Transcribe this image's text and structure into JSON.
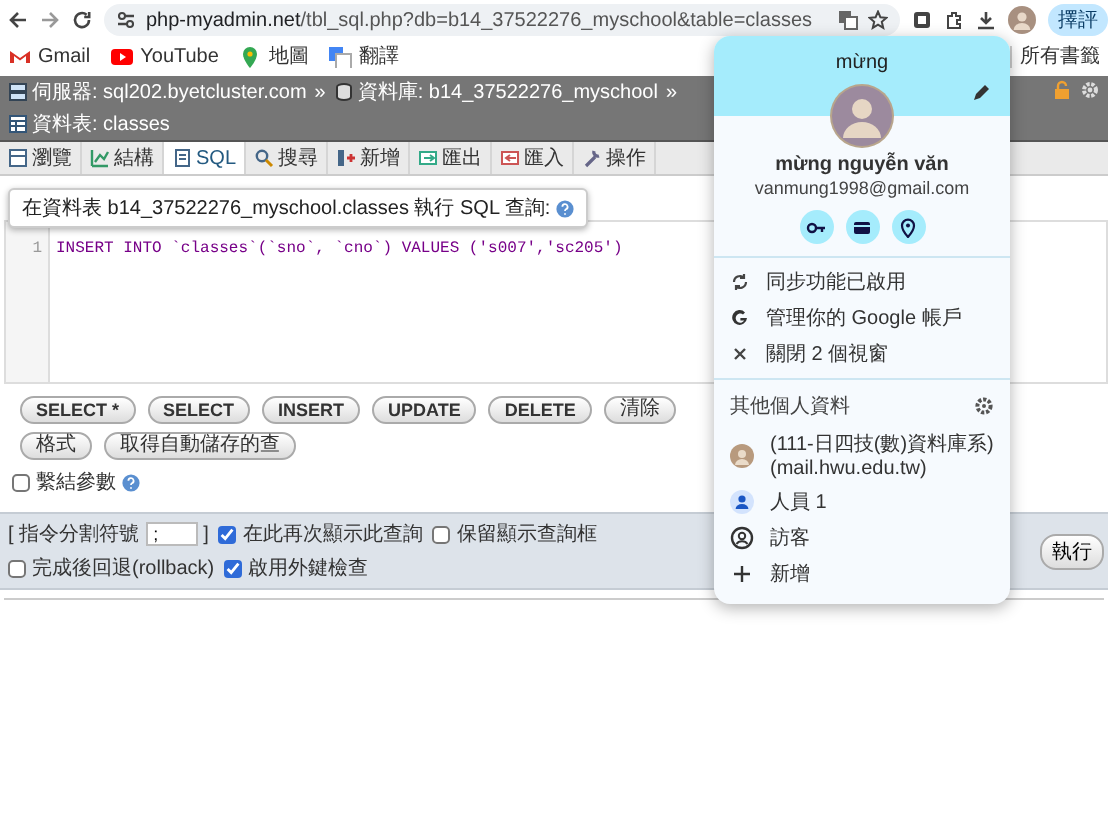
{
  "browser": {
    "url_host": "php-myadmin.net",
    "url_path": "/tbl_sql.php?db=b14_37522276_myschool&table=classes",
    "profile_pill": "擇評",
    "bookmarks": [
      {
        "kind": "gmail",
        "label": "Gmail"
      },
      {
        "kind": "youtube",
        "label": "YouTube"
      },
      {
        "kind": "maps",
        "label": "地圖"
      },
      {
        "kind": "translate",
        "label": "翻譯"
      }
    ],
    "all_bookmarks": "所有書籤"
  },
  "breadcrumb": {
    "separator": "»",
    "items": [
      {
        "kind": "server",
        "label": "伺服器: sql202.byetcluster.com"
      },
      {
        "kind": "database",
        "label": "資料庫: b14_37522276_myschool"
      },
      {
        "kind": "table",
        "label": "資料表: classes"
      }
    ]
  },
  "tabs": [
    {
      "kind": "browse",
      "label": "瀏覽",
      "selected": false
    },
    {
      "kind": "structure",
      "label": "結構",
      "selected": false
    },
    {
      "kind": "sql",
      "label": "SQL",
      "selected": true
    },
    {
      "kind": "search",
      "label": "搜尋",
      "selected": false
    },
    {
      "kind": "insert",
      "label": "新增",
      "selected": false
    },
    {
      "kind": "export",
      "label": "匯出",
      "selected": false
    },
    {
      "kind": "import",
      "label": "匯入",
      "selected": false
    },
    {
      "kind": "operations",
      "label": "操作",
      "selected": false
    }
  ],
  "query": {
    "heading": "在資料表 b14_37522276_myschool.classes 執行 SQL 查詢:",
    "line_numbers": [
      "1"
    ],
    "code": "INSERT INTO `classes`(`sno`, `cno`) VALUES ('s007','sc205')"
  },
  "buttons": [
    "SELECT *",
    "SELECT",
    "INSERT",
    "UPDATE",
    "DELETE",
    "清除",
    "格式",
    "取得自動儲存的查"
  ],
  "bind_parameters": {
    "label": "繫結參數",
    "checked": false
  },
  "options": {
    "delimiter_label": "[ 指令分割符號",
    "delimiter_value": ";",
    "delimiter_close": "]",
    "checkboxes": [
      {
        "label": "在此再次顯示此查詢",
        "checked": true
      },
      {
        "label": "保留顯示查詢框",
        "checked": false
      },
      {
        "label": "完成後回退(rollback)",
        "checked": false
      },
      {
        "label": "啟用外鍵檢查",
        "checked": true
      }
    ],
    "go_button": "執行"
  },
  "profile": {
    "greeting": "mừng",
    "name": "mừng nguyễn văn",
    "email": "vanmung1998@gmail.com",
    "menu": [
      {
        "kind": "sync",
        "label": "同步功能已啟用"
      },
      {
        "kind": "google",
        "label": "管理你的 Google 帳戶"
      },
      {
        "kind": "close",
        "label": "關閉 2 個視窗"
      }
    ],
    "others_heading": "其他個人資料",
    "profiles": [
      {
        "kind": "avatar",
        "label": "(111-日四技(數)資料庫系) (mail.hwu.edu.tw)"
      },
      {
        "kind": "person",
        "label": "人員 1"
      },
      {
        "kind": "guest",
        "label": "訪客"
      },
      {
        "kind": "add",
        "label": "新增"
      }
    ]
  }
}
